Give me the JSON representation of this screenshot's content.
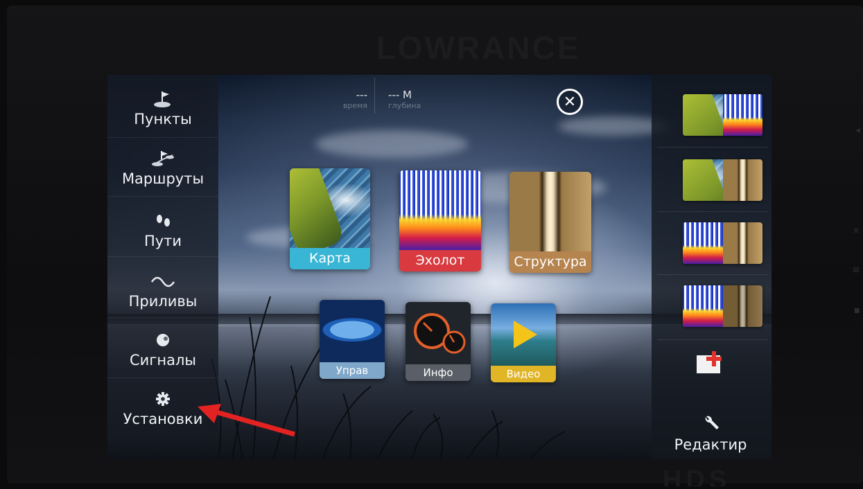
{
  "device": {
    "brand_top": "LOWRANCE",
    "brand_bottom": "HDS"
  },
  "left_menu": [
    {
      "label": "Пункты",
      "icon": "waypoint-flag-icon"
    },
    {
      "label": "Маршруты",
      "icon": "route-icon"
    },
    {
      "label": "Пути",
      "icon": "footsteps-icon"
    },
    {
      "label": "Приливы",
      "icon": "tide-wave-icon"
    },
    {
      "label": "Сигналы",
      "icon": "alarm-bell-icon"
    },
    {
      "label": "Установки",
      "icon": "gear-icon"
    }
  ],
  "status": {
    "time_value": "---",
    "time_caption": "время",
    "depth_value": "--- М",
    "depth_caption": "глубина"
  },
  "apps": {
    "main": [
      {
        "label": "Карта",
        "color": "#39b6d6"
      },
      {
        "label": "Эхолот",
        "color": "#d83a3f"
      },
      {
        "label": "Структура",
        "color": "#b5844f"
      }
    ],
    "secondary": [
      {
        "label": "Управ",
        "color": "#7fa7c9"
      },
      {
        "label": "Инфо",
        "color": "#5a5f67"
      },
      {
        "label": "Видео",
        "color": "#e0b526"
      }
    ]
  },
  "right_panel": {
    "edit_label": "Редактир"
  },
  "colors": {
    "accent_arrow": "#e32222",
    "new_page_plus": "#e0332e"
  }
}
